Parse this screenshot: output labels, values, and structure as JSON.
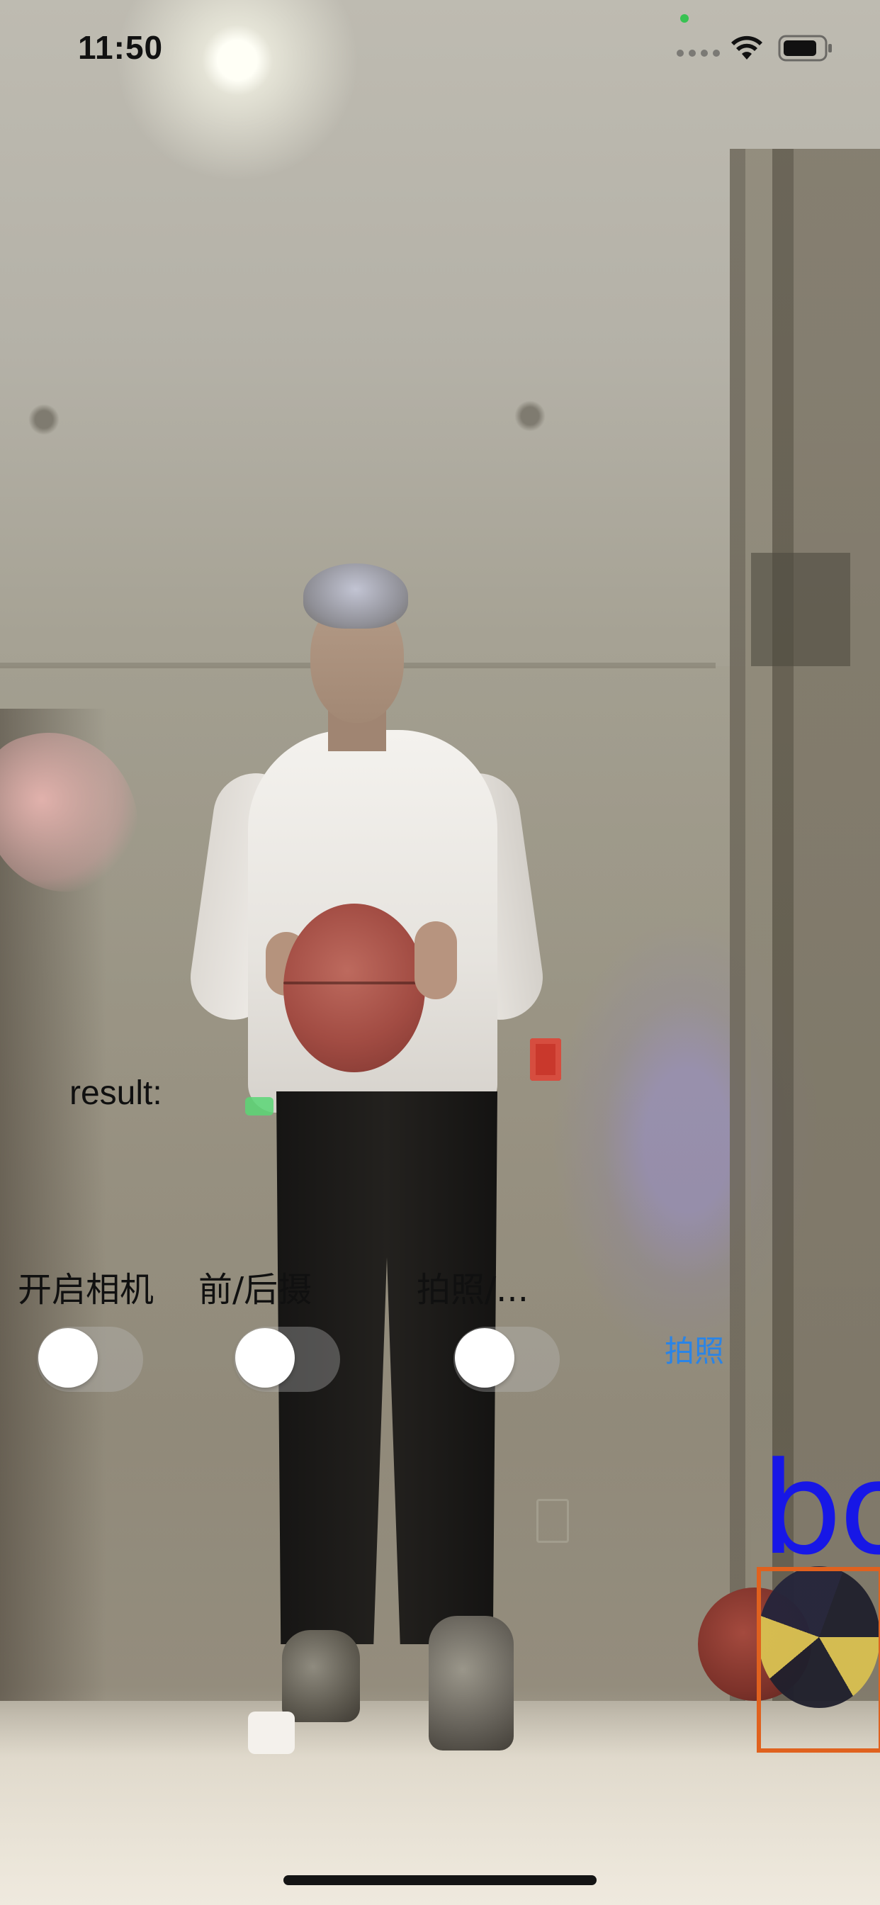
{
  "status_bar": {
    "time": "11:50"
  },
  "camera_view": {
    "result_label": "result:",
    "detection": {
      "label": "bo",
      "box_color": "#e0611e",
      "label_color": "#1717e6"
    }
  },
  "controls": {
    "toggles": [
      {
        "label": "开启相机",
        "on": false
      },
      {
        "label": "前/后摄",
        "on": false
      },
      {
        "label": "拍照/...",
        "on": false
      }
    ],
    "photo_button_label": "拍照",
    "accent_color": "#2a84e6"
  },
  "icons": {
    "wifi": "wifi-icon",
    "battery": "battery-icon",
    "cellular": "cellular-signal-icon"
  }
}
